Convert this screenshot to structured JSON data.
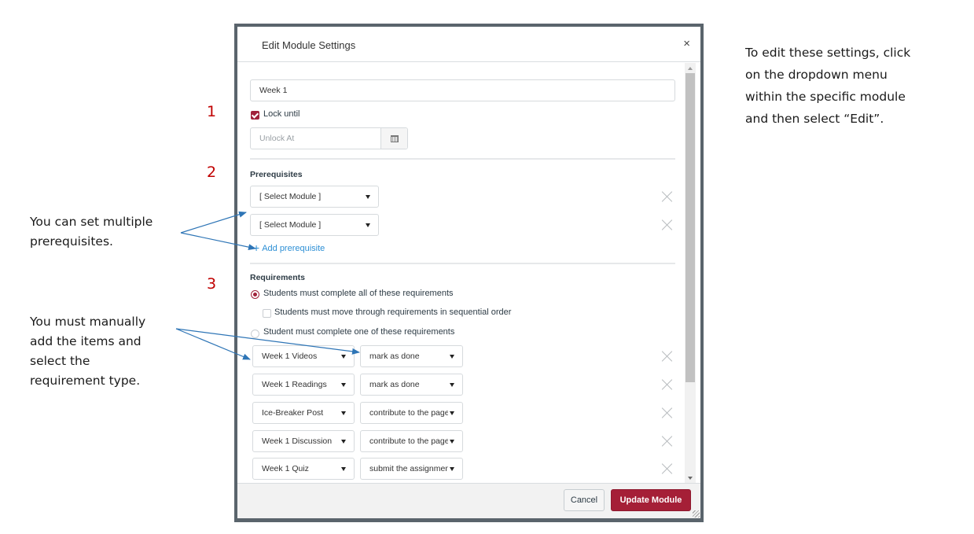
{
  "annotations": {
    "step_numbers": [
      "1",
      "2",
      "3"
    ],
    "callout_prerequisites": [
      "You can set multiple",
      "prerequisites."
    ],
    "callout_requirements": [
      "You must manually",
      "add the items and",
      "select the",
      "requirement type."
    ],
    "callout_instructions": [
      "To edit these settings, click",
      "on the dropdown menu",
      "within the specific module",
      "and then select “Edit”."
    ]
  },
  "dialog": {
    "title": "Edit Module Settings",
    "close_label": "×",
    "module_name": {
      "value": "Week 1"
    },
    "lock_until": {
      "label": "Lock until",
      "checked": true
    },
    "unlock_at": {
      "placeholder": "Unlock At",
      "value": "",
      "icon": "calendar-icon"
    },
    "prerequisites": {
      "heading": "Prerequisites",
      "items": [
        {
          "value": "[ Select Module ]"
        },
        {
          "value": "[ Select Module ]"
        }
      ],
      "add_label": "Add prerequisite"
    },
    "requirements": {
      "heading": "Requirements",
      "options": [
        {
          "label": "Students must complete all of these requirements",
          "selected": true
        },
        {
          "label": "Students must move through requirements in sequential order",
          "checked": false
        },
        {
          "label": "Student must complete one of these requirements",
          "selected": false
        }
      ],
      "items": [
        {
          "item": "Week 1 Videos",
          "type": "mark as done"
        },
        {
          "item": "Week 1 Readings",
          "type": "mark as done"
        },
        {
          "item": "Ice-Breaker Post",
          "type": "contribute to the page"
        },
        {
          "item": "Week 1 Discussion",
          "type": "contribute to the page"
        },
        {
          "item": "Week 1 Quiz",
          "type": "submit the assignment"
        }
      ]
    },
    "footer": {
      "cancel_label": "Cancel",
      "submit_label": "Update Module"
    }
  },
  "colors": {
    "brand": "#a51f37",
    "link": "#2d8fd5",
    "annotation_number": "#c00000",
    "annotation_arrow": "#2e75b6"
  }
}
